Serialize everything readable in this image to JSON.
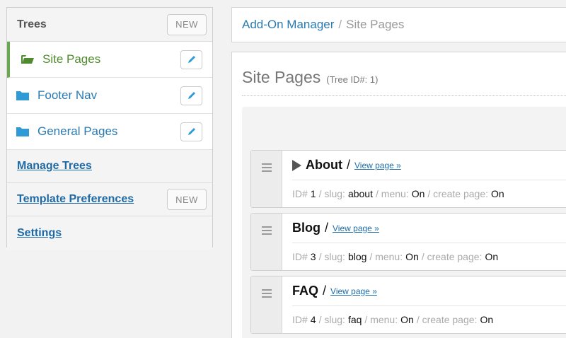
{
  "sidebar": {
    "title": "Trees",
    "new_label": "NEW",
    "trees": [
      {
        "label": "Site Pages",
        "active": true
      },
      {
        "label": "Footer Nav",
        "active": false
      },
      {
        "label": "General Pages",
        "active": false
      }
    ],
    "links": [
      {
        "label": "Manage Trees",
        "has_new": false
      },
      {
        "label": "Template Preferences",
        "has_new": true,
        "new_label": "NEW"
      },
      {
        "label": "Settings",
        "has_new": false
      }
    ]
  },
  "breadcrumb": {
    "parent": "Add-On Manager",
    "separator": "/",
    "current": "Site Pages"
  },
  "main": {
    "title": "Site Pages",
    "tree_id_label": "(Tree ID#: 1)",
    "pages": [
      {
        "title": "About",
        "expandable": true,
        "view_label": "View page »",
        "id": "1",
        "slug": "about",
        "menu": "On",
        "create_page": "On"
      },
      {
        "title": "Blog",
        "expandable": false,
        "view_label": "View page »",
        "id": "3",
        "slug": "blog",
        "menu": "On",
        "create_page": "On"
      },
      {
        "title": "FAQ",
        "expandable": false,
        "view_label": "View page »",
        "id": "4",
        "slug": "faq",
        "menu": "On",
        "create_page": "On"
      }
    ],
    "meta_labels": {
      "id": "ID#",
      "slug": "/ slug:",
      "menu": "/ menu:",
      "create_page": "/ create page:"
    },
    "title_separator": "/"
  },
  "colors": {
    "accent_green": "#6aa84f",
    "link_blue": "#2a7ab0",
    "folder_blue": "#2e9ad6"
  }
}
